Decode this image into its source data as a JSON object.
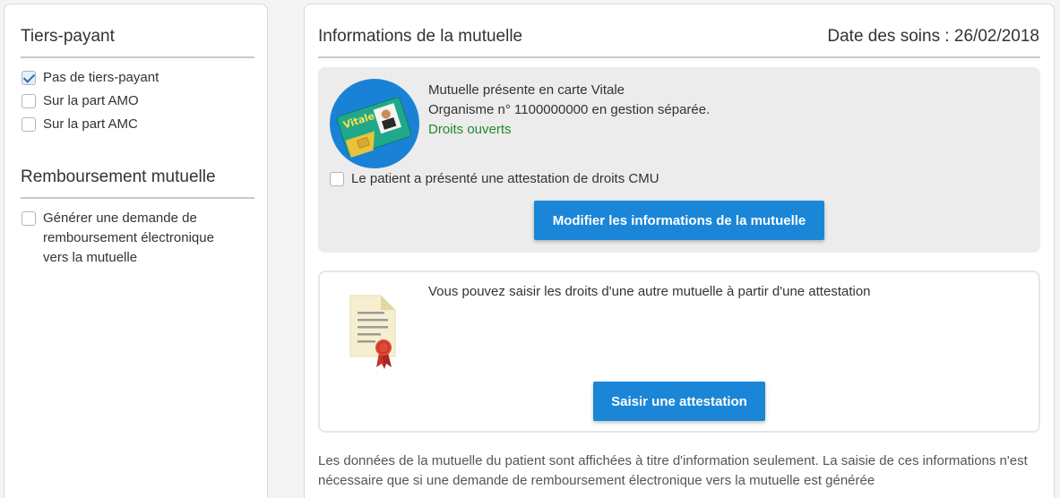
{
  "left": {
    "tiers_payant": {
      "title": "Tiers-payant",
      "options": [
        {
          "label": "Pas de tiers-payant",
          "checked": true
        },
        {
          "label": "Sur la part AMO",
          "checked": false
        },
        {
          "label": "Sur la part AMC",
          "checked": false
        }
      ]
    },
    "remboursement": {
      "title": "Remboursement mutuelle",
      "option": {
        "label": "Générer une demande de remboursement électronique vers la mutuelle",
        "checked": false
      },
      "option_lines": [
        "Générer une demande de",
        "remboursement électronique",
        "vers la mutuelle"
      ]
    }
  },
  "main": {
    "title": "Informations de la mutuelle",
    "date_label": "Date des soins : 26/02/2018",
    "vitale": {
      "card_text": "Vitale",
      "line1": "Mutuelle présente en carte Vitale",
      "line2": "Organisme n° 1100000000 en gestion séparée.",
      "status": "Droits ouverts",
      "status_color": "#1f8a2c",
      "cmu_label": "Le patient a présenté une attestation de droits CMU",
      "cmu_checked": false,
      "modify_button": "Modifier les informations de la mutuelle"
    },
    "attestation": {
      "text": "Vous pouvez saisir les droits d'une autre mutuelle à partir d'une attestation",
      "button": "Saisir une attestation",
      "icon": "certificate-icon"
    },
    "footnote": "Les données de la mutuelle du patient sont affichées à titre d'information seulement. La saisie de ces informations n'est nécessaire que si une demande de remboursement électronique vers la mutuelle est générée"
  },
  "colors": {
    "accent": "#1b86d7",
    "success": "#1f8a2c"
  }
}
